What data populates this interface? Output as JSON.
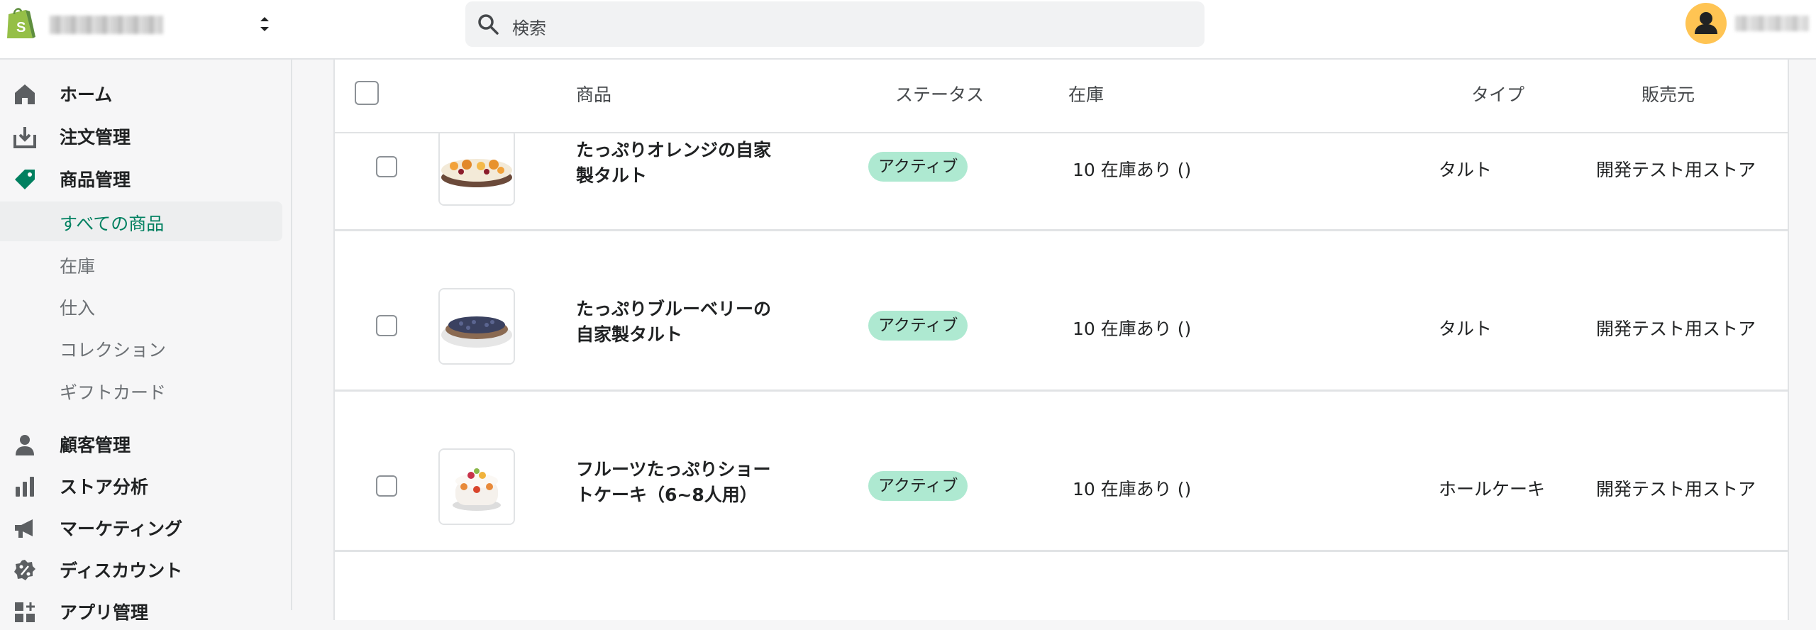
{
  "topbar": {
    "search_placeholder": "検索"
  },
  "sidebar": {
    "items": [
      {
        "label": "ホーム",
        "icon": "home-icon"
      },
      {
        "label": "注文管理",
        "icon": "orders-icon"
      },
      {
        "label": "商品管理",
        "icon": "tag-icon"
      },
      {
        "label": "顧客管理",
        "icon": "person-icon"
      },
      {
        "label": "ストア分析",
        "icon": "bar-chart-icon"
      },
      {
        "label": "マーケティング",
        "icon": "megaphone-icon"
      },
      {
        "label": "ディスカウント",
        "icon": "discount-icon"
      },
      {
        "label": "アプリ管理",
        "icon": "apps-icon"
      }
    ],
    "sub_items": [
      {
        "label": "すべての商品",
        "active": true
      },
      {
        "label": "在庫",
        "active": false
      },
      {
        "label": "仕入",
        "active": false
      },
      {
        "label": "コレクション",
        "active": false
      },
      {
        "label": "ギフトカード",
        "active": false
      }
    ]
  },
  "table": {
    "headers": {
      "product": "商品",
      "status": "ステータス",
      "inventory": "在庫",
      "type": "タイプ",
      "vendor": "販売元"
    },
    "rows": [
      {
        "name_line1": "たっぷりオレンジの自家",
        "name_line2": "製タルト",
        "status": "アクティブ",
        "inventory": "10 在庫あり ()",
        "type": "タルト",
        "vendor": "開発テスト用ストア",
        "thumb": "orange-tart-thumbnail"
      },
      {
        "name_line1": "たっぷりブルーベリーの",
        "name_line2": "自家製タルト",
        "status": "アクティブ",
        "inventory": "10 在庫あり ()",
        "type": "タルト",
        "vendor": "開発テスト用ストア",
        "thumb": "blueberry-tart-thumbnail"
      },
      {
        "name_line1": "フルーツたっぷりショー",
        "name_line2": "トケーキ（6~8人用）",
        "status": "アクティブ",
        "inventory": "10 在庫あり ()",
        "type": "ホールケーキ",
        "vendor": "開発テスト用ストア",
        "thumb": "shortcake-thumbnail"
      }
    ]
  },
  "colors": {
    "brand_green": "#008060",
    "badge_green": "#aee9d1",
    "avatar_yellow": "#ffc453",
    "shopify_green": "#95bf47"
  }
}
